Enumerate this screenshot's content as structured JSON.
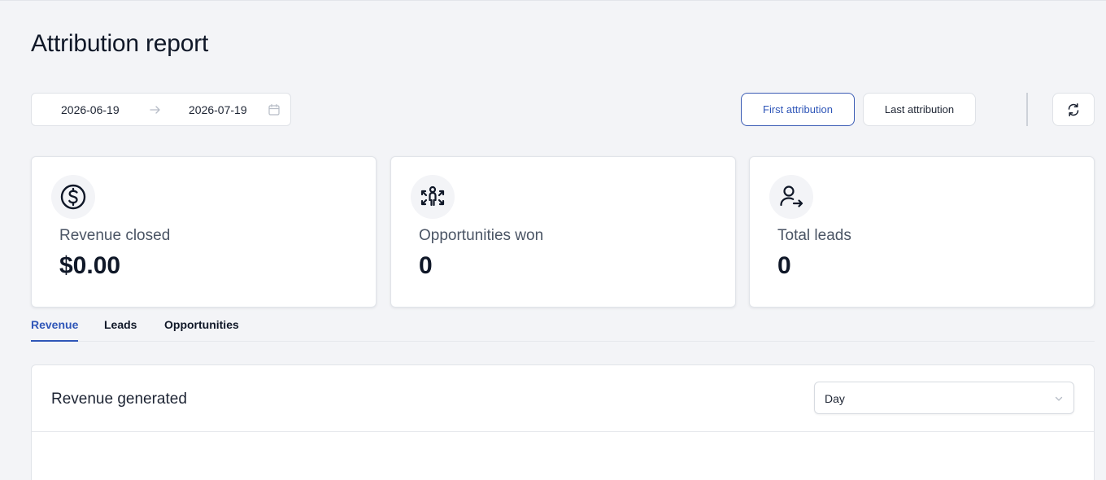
{
  "page": {
    "title": "Attribution report"
  },
  "date_range": {
    "start": "2026-06-19",
    "end": "2026-07-19"
  },
  "attribution": {
    "first_label": "First attribution",
    "last_label": "Last attribution",
    "selected": "first"
  },
  "stats": [
    {
      "label": "Revenue closed",
      "value": "$0.00",
      "icon": "dollar-circle-icon"
    },
    {
      "label": "Opportunities won",
      "value": "0",
      "icon": "opportunities-icon"
    },
    {
      "label": "Total leads",
      "value": "0",
      "icon": "user-arrow-icon"
    }
  ],
  "tabs": [
    {
      "label": "Revenue",
      "active": true
    },
    {
      "label": "Leads",
      "active": false
    },
    {
      "label": "Opportunities",
      "active": false
    }
  ],
  "revenue_panel": {
    "title": "Revenue generated",
    "granularity": "Day"
  },
  "colors": {
    "accent": "#2f56b8",
    "background": "#f3f4f7"
  }
}
